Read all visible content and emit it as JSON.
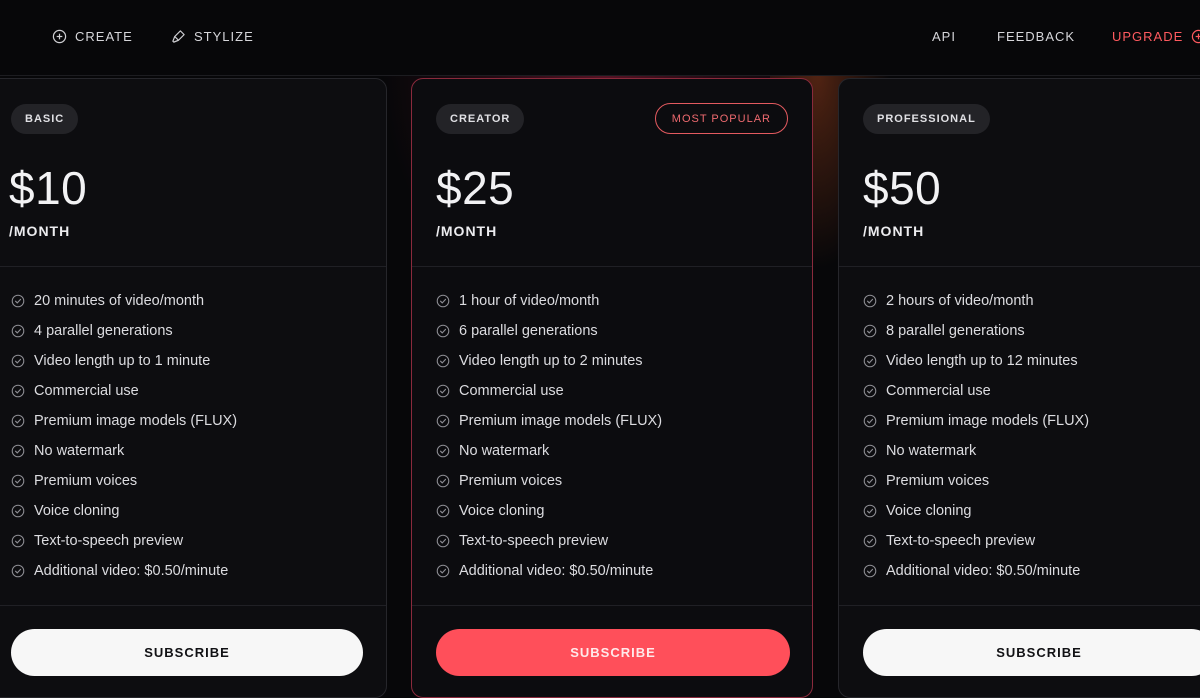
{
  "nav": {
    "create": "CREATE",
    "stylize": "STYLIZE",
    "api": "API",
    "feedback": "FEEDBACK",
    "upgrade": "UPGRADE"
  },
  "colors": {
    "accent": "#ff4f5a",
    "background": "#070709",
    "card": "#0d0d10"
  },
  "plans": [
    {
      "tier": "BASIC",
      "price": "$10",
      "period": "/MONTH",
      "features": [
        "20 minutes of video/month",
        "4 parallel generations",
        "Video length up to 1 minute",
        "Commercial use",
        "Premium image models (FLUX)",
        "No watermark",
        "Premium voices",
        "Voice cloning",
        "Text-to-speech preview",
        "Additional video: $0.50/minute"
      ],
      "button": "SUBSCRIBE"
    },
    {
      "tier": "CREATOR",
      "badge": "MOST POPULAR",
      "price": "$25",
      "period": "/MONTH",
      "features": [
        "1 hour of video/month",
        "6 parallel generations",
        "Video length up to 2 minutes",
        "Commercial use",
        "Premium image models (FLUX)",
        "No watermark",
        "Premium voices",
        "Voice cloning",
        "Text-to-speech preview",
        "Additional video: $0.50/minute"
      ],
      "button": "SUBSCRIBE"
    },
    {
      "tier": "PROFESSIONAL",
      "price": "$50",
      "period": "/MONTH",
      "features": [
        "2 hours of video/month",
        "8 parallel generations",
        "Video length up to 12 minutes",
        "Commercial use",
        "Premium image models (FLUX)",
        "No watermark",
        "Premium voices",
        "Voice cloning",
        "Text-to-speech preview",
        "Additional video: $0.50/minute"
      ],
      "button": "SUBSCRIBE"
    }
  ]
}
